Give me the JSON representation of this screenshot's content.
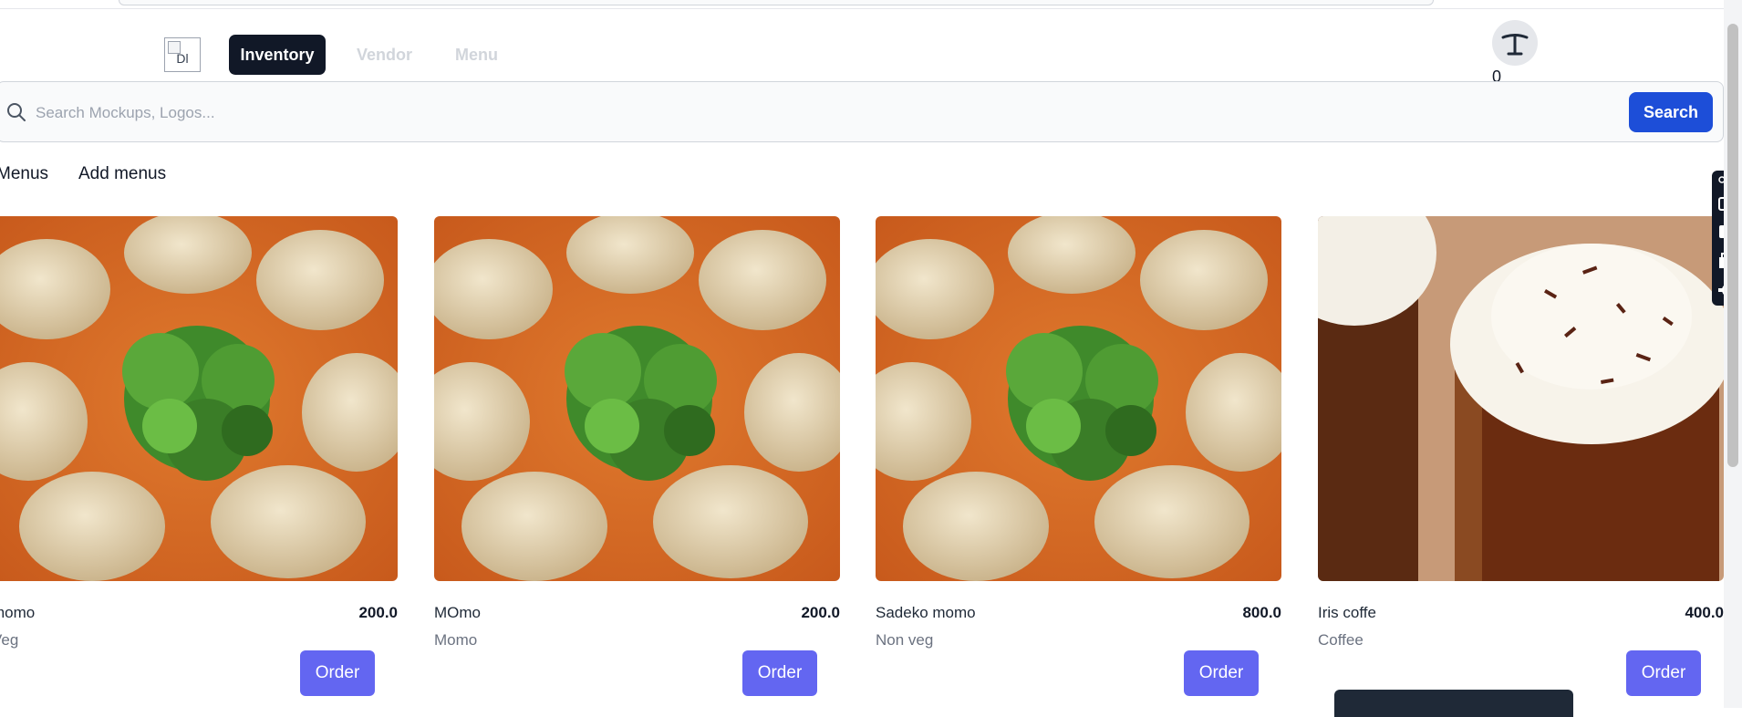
{
  "header": {
    "logo_alt": "Dl",
    "nav": {
      "inventory": "Inventory",
      "vendor": "Vendor",
      "menu": "Menu"
    },
    "cart_count": "0"
  },
  "search": {
    "placeholder": "Search Mockups, Logos...",
    "button_label": "Search"
  },
  "subtabs": {
    "menus": "Menus",
    "add_menus": "Add menus"
  },
  "cards": [
    {
      "name": "momo",
      "price": "200.0",
      "category": "Veg",
      "order_label": "Order",
      "image": "momo-dumplings"
    },
    {
      "name": "MOmo",
      "price": "200.0",
      "category": "Momo",
      "order_label": "Order",
      "image": "momo-dumplings"
    },
    {
      "name": "Sadeko momo",
      "price": "800.0",
      "category": "Non veg",
      "order_label": "Order",
      "image": "momo-dumplings"
    },
    {
      "name": "Iris coffe",
      "price": "400.0",
      "category": "Coffee",
      "order_label": "Order",
      "image": "irish-coffee"
    }
  ],
  "colors": {
    "nav_active_bg": "#111827",
    "search_button": "#1d4ed8",
    "order_button": "#6366f1"
  },
  "side_toolbar": [
    "link-icon",
    "camera-icon",
    "video-icon",
    "window-icon",
    "gear-icon"
  ]
}
